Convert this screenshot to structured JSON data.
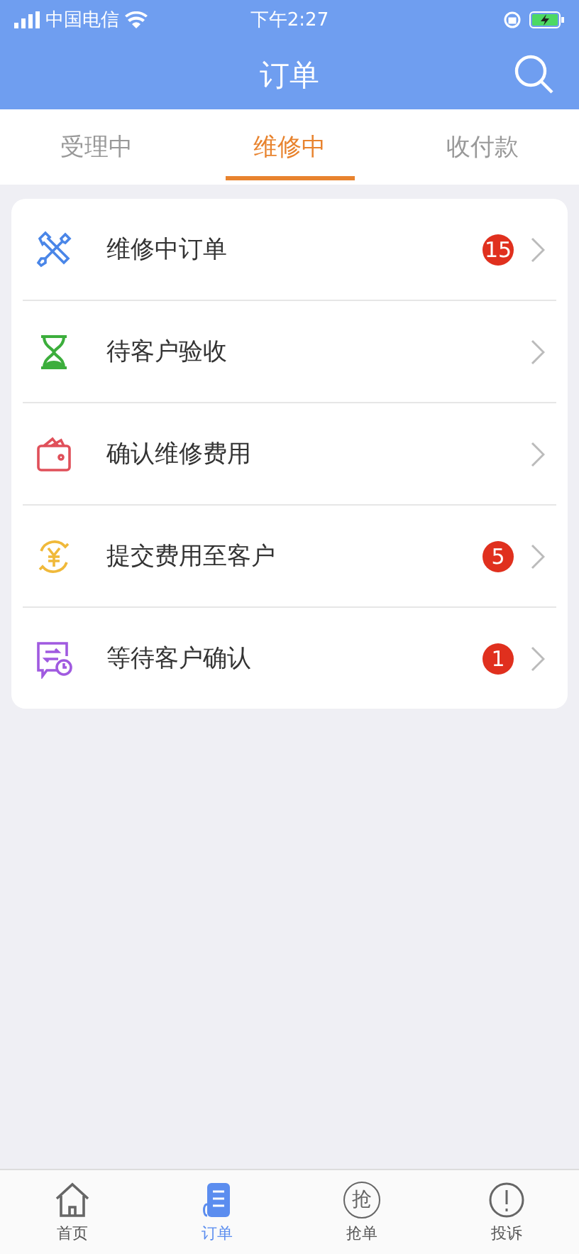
{
  "status_bar": {
    "carrier": "中国电信",
    "time": "下午2:27"
  },
  "header": {
    "title": "订单"
  },
  "tabs": [
    {
      "label": "受理中",
      "selected": false
    },
    {
      "label": "维修中",
      "selected": true
    },
    {
      "label": "收付款",
      "selected": false
    }
  ],
  "menu": [
    {
      "kind": "tools",
      "label": "维修中订单",
      "badge": "15"
    },
    {
      "kind": "hourglass",
      "label": "待客户验收"
    },
    {
      "kind": "wallet",
      "label": "确认维修费用"
    },
    {
      "kind": "yuan",
      "label": "提交费用至客户",
      "badge": "5"
    },
    {
      "kind": "clock",
      "label": "等待客户确认",
      "badge": "1"
    }
  ],
  "tab_bar": [
    {
      "kind": "home",
      "label": "首页",
      "selected": false
    },
    {
      "kind": "orders",
      "label": "订单",
      "selected": true
    },
    {
      "kind": "grab",
      "glyph": "抢",
      "label": "抢单",
      "selected": false
    },
    {
      "kind": "alert",
      "label": "投诉",
      "selected": false
    }
  ]
}
